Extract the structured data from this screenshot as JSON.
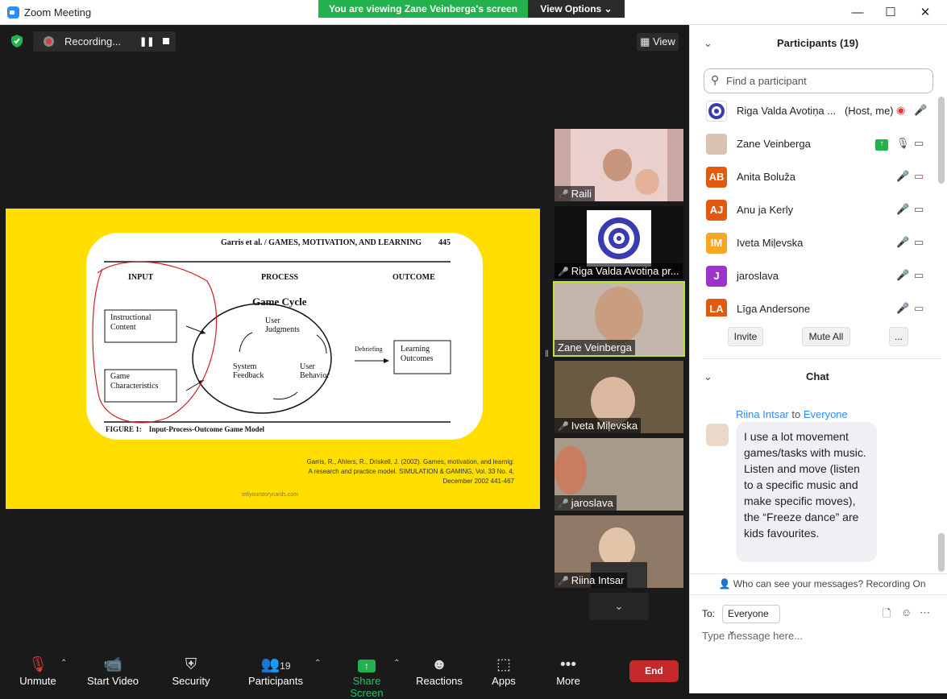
{
  "window": {
    "title": "Zoom Meeting",
    "minimize": "—",
    "maximize": "☐",
    "close": "✕"
  },
  "banner": {
    "viewing": "You are viewing Zane Veinberga's screen",
    "view_options": "View Options ⌄"
  },
  "recording": {
    "label": "Recording...",
    "pause": "❚❚"
  },
  "view_button": "▦ View",
  "slide": {
    "header": "Garris et al. / GAMES, MOTIVATION, AND LEARNING",
    "page": "445",
    "input": "INPUT",
    "process": "PROCESS",
    "outcome": "OUTCOME",
    "instructional": "Instructional Content",
    "game_char": "Game Characteristics",
    "cycle": "Game Cycle",
    "user_judgments": "User Judgments",
    "user_behavior": "User Behavior",
    "system_feedback": "System Feedback",
    "debriefing": "Debriefing",
    "learning_outcomes": "Learning Outcomes",
    "figure_caption": "FIGURE 1:    Input-Process-Outcome Game Model",
    "citation_1": "Garris, R., Ahlers, R., Driskell, J. (2002). Games, motivation, and learnig:",
    "citation_2": "A research and practice model. SIMULATION & GAMING, Vol. 33 No. 4,",
    "citation_3": "December 2002 441-467",
    "watermark": "tellyourstorycards.com"
  },
  "tiles": [
    {
      "name": "Raili"
    },
    {
      "name": "Riga Valda Avotiņa pr..."
    },
    {
      "name": "Zane Veinberga"
    },
    {
      "name": "Iveta Miļevska"
    },
    {
      "name": "jaroslava"
    },
    {
      "name": "Riina Intsar"
    }
  ],
  "toolbar": {
    "unmute": "Unmute",
    "start_video": "Start Video",
    "security": "Security",
    "participants": "Participants",
    "participants_count": "19",
    "share_screen": "Share Screen",
    "reactions": "Reactions",
    "apps": "Apps",
    "more": "More",
    "end": "End"
  },
  "participants_panel": {
    "title": "Participants (19)",
    "search_placeholder": "Find a participant",
    "rows": [
      {
        "initials": "",
        "name": "Riga Valda Avotiņa ...",
        "role": "(Host, me)",
        "color": "#ffffff"
      },
      {
        "initials": "",
        "name": "Zane Veinberga",
        "role": "",
        "color": "#d9c2b0"
      },
      {
        "initials": "AB",
        "name": "Anita Boluža",
        "role": "",
        "color": "#e05a10"
      },
      {
        "initials": "AJ",
        "name": "Anu ja Kerly",
        "role": "",
        "color": "#e05a10"
      },
      {
        "initials": "IM",
        "name": "Iveta Miļevska",
        "role": "",
        "color": "#f5a623"
      },
      {
        "initials": "J",
        "name": "jaroslava",
        "role": "",
        "color": "#9b35c9"
      },
      {
        "initials": "LA",
        "name": "Līga Andersone",
        "role": "",
        "color": "#e05a10"
      }
    ],
    "invite": "Invite",
    "mute_all": "Mute All",
    "more": "..."
  },
  "chat": {
    "title": "Chat",
    "sender": "Riina Intsar",
    "to_word": "to",
    "recipient": "Everyone",
    "message": "I use a lot movement games/tasks with music. Listen and move (listen to a specific music and make specific moves), the “Freeze dance” are kids favourites.",
    "who_can_see": "Who can see your messages? Recording On",
    "to_label": "To:",
    "to_value": "Everyone ⌄",
    "input_placeholder": "Type message here..."
  }
}
